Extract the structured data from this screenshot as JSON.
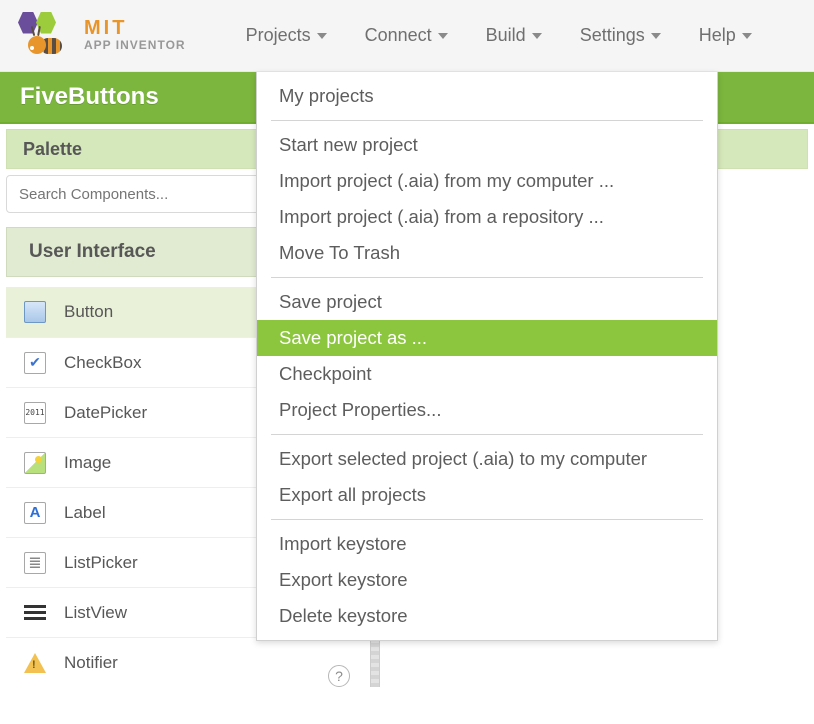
{
  "brand": {
    "line1": "MIT",
    "line2": "APP INVENTOR"
  },
  "menus": [
    "Projects",
    "Connect",
    "Build",
    "Settings",
    "Help"
  ],
  "active_menu_index": 0,
  "project_name": "FiveButtons",
  "palette_title": "Palette",
  "search_placeholder": "Search Components...",
  "accordion_title": "User Interface",
  "components": [
    {
      "name": "Button",
      "icon": "button",
      "selected": true
    },
    {
      "name": "CheckBox",
      "icon": "checkbox",
      "selected": false
    },
    {
      "name": "DatePicker",
      "icon": "datepicker",
      "selected": false
    },
    {
      "name": "Image",
      "icon": "image",
      "selected": false
    },
    {
      "name": "Label",
      "icon": "label",
      "selected": false
    },
    {
      "name": "ListPicker",
      "icon": "listpicker",
      "selected": false
    },
    {
      "name": "ListView",
      "icon": "listview",
      "selected": false
    },
    {
      "name": "Notifier",
      "icon": "notifier",
      "selected": false
    }
  ],
  "dropdown": {
    "groups": [
      [
        "My projects"
      ],
      [
        "Start new project",
        "Import project (.aia) from my computer ...",
        "Import project (.aia) from a repository ...",
        "Move To Trash"
      ],
      [
        "Save project",
        "Save project as ...",
        "Checkpoint",
        "Project Properties..."
      ],
      [
        "Export selected project (.aia) to my computer",
        "Export all projects"
      ],
      [
        "Import keystore",
        "Export keystore",
        "Delete keystore"
      ]
    ],
    "highlighted": "Save project as ..."
  }
}
